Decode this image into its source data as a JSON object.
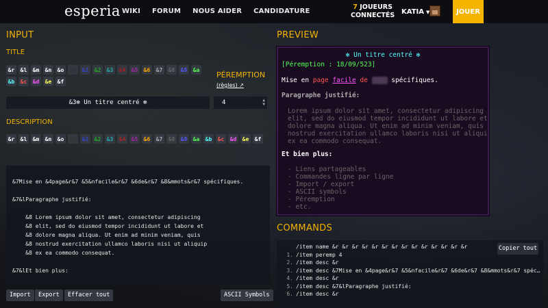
{
  "nav": {
    "logo": "esperia",
    "links": [
      "WIKI",
      "FORUM",
      "NOUS AIDER",
      "CANDIDATURE"
    ],
    "players_count": "7",
    "players_label_1": "JOUEURS",
    "players_label_2": "CONNECTÉS",
    "user": "KATIA",
    "play_button": "JOUER"
  },
  "input": {
    "heading": "INPUT",
    "title_label": "TITLE",
    "title_buttons": [
      {
        "label": "&r",
        "color": "#ffffff"
      },
      {
        "label": "&l",
        "color": "#ffffff"
      },
      {
        "label": "&m",
        "color": "#ffffff"
      },
      {
        "label": "&n",
        "color": "#ffffff"
      },
      {
        "label": "&o",
        "color": "#ffffff"
      },
      {
        "label": "&0",
        "color": "#333333"
      },
      {
        "label": "&1",
        "color": "#3344cc"
      },
      {
        "label": "&2",
        "color": "#22aa22"
      },
      {
        "label": "&3",
        "color": "#22aaaa"
      },
      {
        "label": "&4",
        "color": "#aa2222"
      },
      {
        "label": "&5",
        "color": "#aa22aa"
      },
      {
        "label": "&6",
        "color": "#ffaa00"
      },
      {
        "label": "&7",
        "color": "#aaaaaa"
      },
      {
        "label": "&8",
        "color": "#666666"
      },
      {
        "label": "&9",
        "color": "#5555ff"
      },
      {
        "label": "&a",
        "color": "#55ff55"
      },
      {
        "label": "&b",
        "color": "#55ffff"
      },
      {
        "label": "&c",
        "color": "#ff5555"
      },
      {
        "label": "&d",
        "color": "#ff55ff"
      },
      {
        "label": "&e",
        "color": "#ffff55"
      },
      {
        "label": "&f",
        "color": "#ffffff"
      }
    ],
    "peremption_label": "PÉREMPTION",
    "regles_link": "(règles) ↗",
    "title_value": "&3✻ Un titre centré ✻",
    "peremption_value": "4",
    "description_label": "DESCRIPTION",
    "desc_buttons": [
      {
        "label": "&r",
        "color": "#ffffff"
      },
      {
        "label": "&l",
        "color": "#ffffff"
      },
      {
        "label": "&m",
        "color": "#ffffff"
      },
      {
        "label": "&n",
        "color": "#ffffff"
      },
      {
        "label": "&o",
        "color": "#ffffff"
      },
      {
        "label": "&0",
        "color": "#333333"
      },
      {
        "label": "&1",
        "color": "#3344cc"
      },
      {
        "label": "&2",
        "color": "#22aa22"
      },
      {
        "label": "&3",
        "color": "#22aaaa"
      },
      {
        "label": "&4",
        "color": "#aa2222"
      },
      {
        "label": "&5",
        "color": "#aa22aa"
      },
      {
        "label": "&6",
        "color": "#ffaa00"
      },
      {
        "label": "&7",
        "color": "#aaaaaa"
      },
      {
        "label": "&8",
        "color": "#666666"
      },
      {
        "label": "&9",
        "color": "#5555ff"
      },
      {
        "label": "&a",
        "color": "#55ff55"
      },
      {
        "label": "&b",
        "color": "#55ffff"
      },
      {
        "label": "&c",
        "color": "#ff5555"
      },
      {
        "label": "&d",
        "color": "#ff55ff"
      },
      {
        "label": "&e",
        "color": "#ffff55"
      },
      {
        "label": "&f",
        "color": "#ffffff"
      }
    ],
    "description_lines": [
      "&7Mise en &4page&r&7 &5&nfacile&r&7 &6de&r&7 &8&mmots&r&7 spécifiques.",
      "",
      "&7&lParagraphe justifié:",
      "",
      "    &8 Lorem ipsum dolor sit amet, consectetur adipiscing",
      "    &8 elit, sed do eiusmod tempor incididunt ut labore et",
      "    &8 dolore magna aliqua. Ut enim ad minim veniam, quis",
      "    &8 nostrud exercitation ullamco laboris nisi ut aliquip",
      "    &8 ex ea commodo consequat.",
      "",
      "&7&lEt bien plus:"
    ],
    "import_button": "Import",
    "export_button": "Export",
    "clear_button": "Effacer tout",
    "ascii_button": "ASCII Symbols"
  },
  "preview": {
    "heading": "PREVIEW",
    "title": "✻ Un titre centré ✻",
    "peremption": "[Péremption : 18/09/523]",
    "line1_a": "Mise en ",
    "line1_page": "page",
    "line1_facile": "facile",
    "line1_de": " de ",
    "line1_mots": "mots",
    "line1_b": " spécifiques.",
    "para_title": "Paragraphe justifié:",
    "para_lines": [
      "Lorem ipsum dolor sit amet, consectetur adipiscing",
      "elit, sed do eiusmod tempor incididunt ut labore et",
      "dolore magna aliqua. Ut enim ad minim veniam, quis",
      "nostrud exercitation ullamco laboris nisi ut aliquip",
      "ex ea commodo consequat."
    ],
    "more_title": "Et bien plus:",
    "more_items": [
      "- Liens partageables",
      "- Commandes ligne par ligne",
      "- Import / export",
      "- ASCII symbols",
      "- Péremption",
      "- etc."
    ]
  },
  "commands": {
    "heading": "COMMANDS",
    "copy_button": "Copier tout",
    "lines": [
      {
        "num": "",
        "text": "/item name &r &r &r &r &r &r &r &r &r &r &r &r &r &r"
      },
      {
        "num": "1.",
        "text": "/item peremp 4"
      },
      {
        "num": "2.",
        "text": "/item desc &r"
      },
      {
        "num": "3.",
        "text": "/item desc &7Mise en &4page&r&7 &5&nfacile&r&7 &6de&r&7 &8&mmots&r&7 spéc…"
      },
      {
        "num": "4.",
        "text": "/item desc &r"
      },
      {
        "num": "5.",
        "text": "/item desc &7&lParagraphe justifié:"
      },
      {
        "num": "6.",
        "text": "/item desc &r"
      }
    ]
  }
}
